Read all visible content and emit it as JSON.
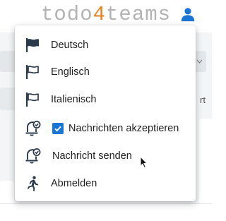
{
  "header": {
    "logo_prefix": "todo",
    "logo_accent": "4",
    "logo_suffix": "teams",
    "logo_accent_color": "#e8821e",
    "user_icon": "user-icon"
  },
  "background": {
    "partial_text": "rt"
  },
  "menu": {
    "items": [
      {
        "icon": "flag-filled-icon",
        "label": "Deutsch"
      },
      {
        "icon": "flag-outline-icon",
        "label": "Englisch"
      },
      {
        "icon": "flag-outline-icon",
        "label": "Italienisch"
      },
      {
        "icon": "bell-check-icon",
        "label": "Nachrichten akzeptieren",
        "checked": true
      },
      {
        "icon": "bell-check-icon",
        "label": "Nachricht senden"
      },
      {
        "icon": "running-person-icon",
        "label": "Abmelden"
      }
    ]
  },
  "colors": {
    "accent": "#1976d2",
    "icon": "#2b3a4a"
  }
}
